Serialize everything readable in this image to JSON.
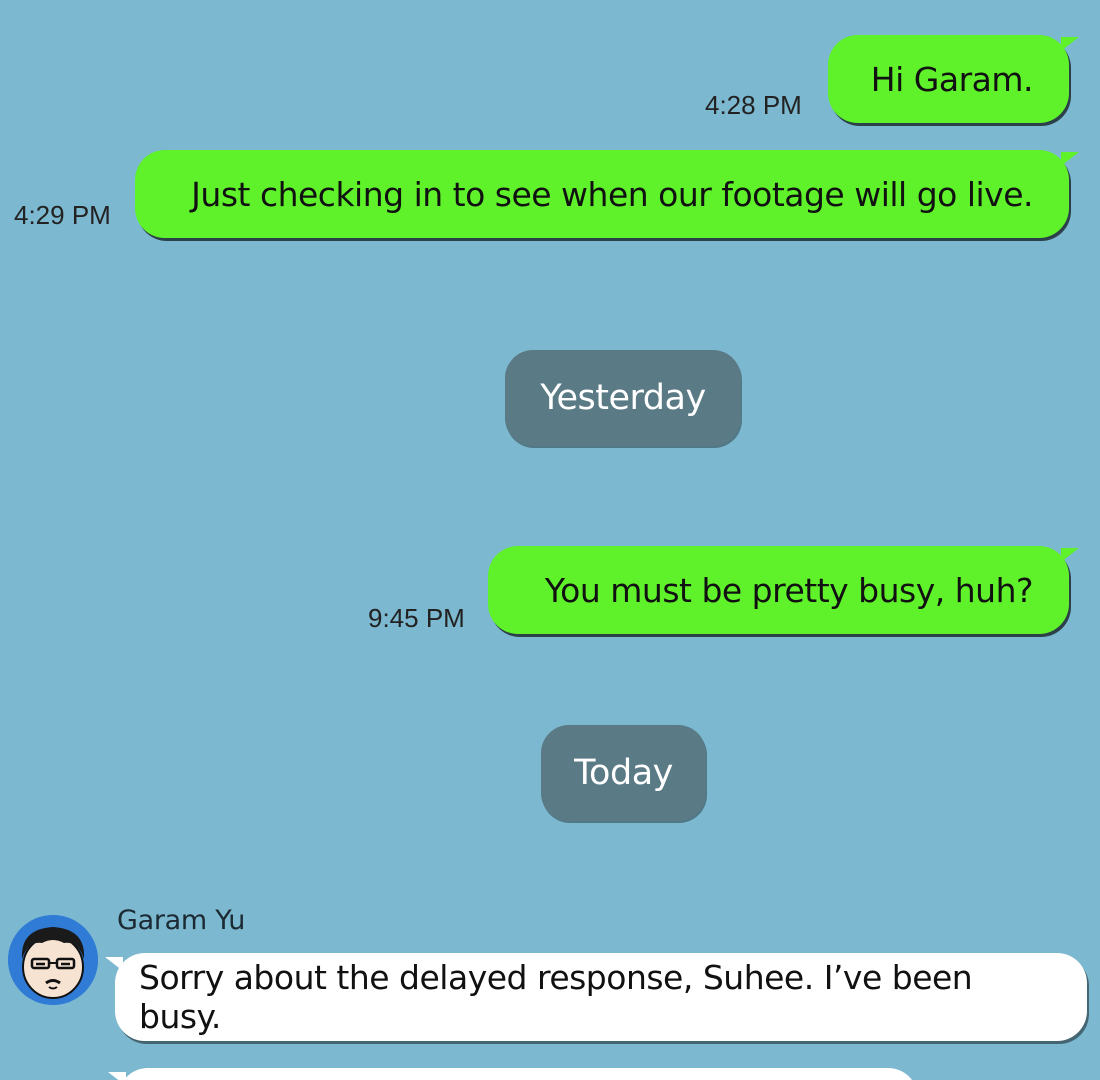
{
  "messages": [
    {
      "text": "Hi Garam.",
      "time": "4:28 PM"
    },
    {
      "text": "Just checking in to see when our footage will go live.",
      "time": "4:29 PM"
    },
    {
      "text": "You must be pretty busy, huh?",
      "time": "9:45 PM"
    }
  ],
  "dividers": {
    "yesterday": "Yesterday",
    "today": "Today"
  },
  "incoming": {
    "sender": "Garam Yu",
    "text": "Sorry about the delayed response, Suhee. I’ve been busy."
  },
  "colors": {
    "background": "#7cb8cf",
    "sent_bubble": "#5ff22a",
    "received_bubble": "#ffffff",
    "date_pill": "#5a7a86",
    "avatar": "#2f7bd6"
  },
  "icons": {
    "avatar": "cartoon-avatar-icon"
  }
}
